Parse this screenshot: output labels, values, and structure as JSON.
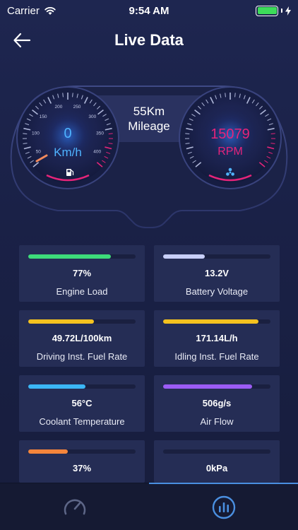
{
  "status_bar": {
    "carrier": "Carrier",
    "time": "9:54 AM"
  },
  "nav": {
    "title": "Live Data"
  },
  "speed_gauge": {
    "value": "0",
    "unit": "Km/h",
    "ticks": [
      "50",
      "100",
      "150",
      "200",
      "250",
      "300",
      "350",
      "400"
    ]
  },
  "mileage": {
    "value": "55Km",
    "label": "Mileage"
  },
  "rpm_gauge": {
    "value": "15079",
    "unit": "RPM"
  },
  "cards": [
    {
      "value": "77%",
      "label": "Engine Load",
      "level": 0.77,
      "color": "#3ddc7a"
    },
    {
      "value": "13.2V",
      "label": "Battery Voltage",
      "level": 0.39,
      "color": "#c8cff8"
    },
    {
      "value": "49.72L/100km",
      "label": "Driving Inst. Fuel Rate",
      "level": 0.61,
      "color": "#f4c21f"
    },
    {
      "value": "171.14L/h",
      "label": "Idling Inst. Fuel Rate",
      "level": 0.89,
      "color": "#f4c21f"
    },
    {
      "value": "56°C",
      "label": "Coolant Temperature",
      "level": 0.53,
      "color": "#3bb6f5"
    },
    {
      "value": "506g/s",
      "label": "Air Flow",
      "level": 0.83,
      "color": "#9b5cf5"
    },
    {
      "value": "37%",
      "label": "",
      "level": 0.37,
      "color": "#f5853b"
    },
    {
      "value": "0kPa",
      "label": "",
      "level": 0,
      "color": "#5b6bd0"
    }
  ],
  "tabs": [
    {
      "name": "gauge-icon",
      "active": false
    },
    {
      "name": "bar-chart-icon",
      "active": true
    }
  ],
  "colors": {
    "accent_pink": "#e6247a",
    "accent_blue": "#4fb4ff",
    "tab_active": "#4a8fe0"
  }
}
